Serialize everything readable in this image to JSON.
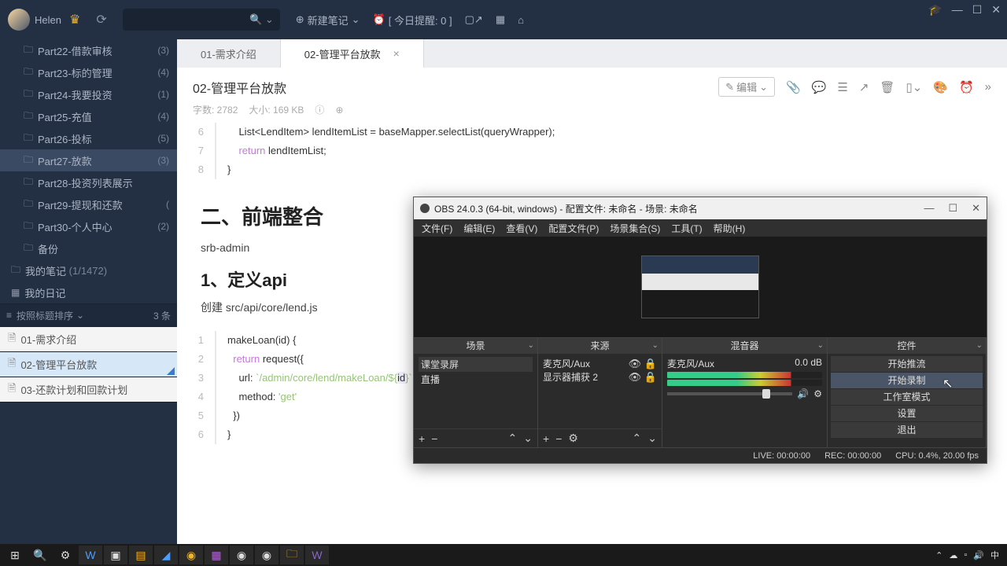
{
  "topbar": {
    "username": "Helen",
    "new_note": "新建笔记",
    "reminder": "[ 今日提醒: 0 ]"
  },
  "sidebar": {
    "folders": [
      {
        "name": "Part22-借款审核",
        "count": "(3)"
      },
      {
        "name": "Part23-标的管理",
        "count": "(4)"
      },
      {
        "name": "Part24-我要投资",
        "count": "(1)"
      },
      {
        "name": "Part25-充值",
        "count": "(4)"
      },
      {
        "name": "Part26-投标",
        "count": "(5)"
      },
      {
        "name": "Part27-放款",
        "count": "(3)"
      },
      {
        "name": "Part28-投资列表展示",
        "count": ""
      },
      {
        "name": "Part29-提现和还款",
        "count": "("
      },
      {
        "name": "Part30-个人中心",
        "count": "(2)"
      },
      {
        "name": "备份",
        "count": ""
      }
    ],
    "my_notes": "我的笔记",
    "my_notes_cnt": "(1/1472)",
    "my_diary": "我的日记",
    "sort_label": "按照标题排序",
    "sort_cnt": "3 条",
    "notes": [
      {
        "t": "01-需求介绍"
      },
      {
        "t": "02-管理平台放款"
      },
      {
        "t": "03-还款计划和回款计划"
      }
    ]
  },
  "tabs": {
    "t1": "01-需求介绍",
    "t2": "02-管理平台放款"
  },
  "doc": {
    "title": "02-管理平台放款",
    "meta_words": "字数: 2782",
    "meta_size": "大小: 169 KB",
    "edit_label": "编辑"
  },
  "code1": {
    "l6": "    List<LendItem> lendItemList = baseMapper.selectList(queryWrapper);",
    "l7a": "    ",
    "l7k": "return",
    "l7b": " lendItemList;",
    "l8": "}"
  },
  "content": {
    "h2": "二、前端整合",
    "p1": "srb-admin",
    "h3": "1、定义api",
    "p2": "创建 src/api/core/lend.js"
  },
  "code2": {
    "l1": "makeLoan(id) {",
    "l2a": "  ",
    "l2k": "return",
    "l2b": " request({",
    "l3a": "    url: ",
    "l3s": "`/admin/core/lend/makeLoan/${",
    "l3i": "id",
    "l3e": "}`",
    "l3c": ",",
    "l4a": "    method: ",
    "l4s": "'get'",
    "l5": "  })",
    "l6": "}"
  },
  "obs": {
    "title": "OBS 24.0.3 (64-bit, windows) - 配置文件: 未命名 - 场景: 未命名",
    "menu": [
      "文件(F)",
      "编辑(E)",
      "查看(V)",
      "配置文件(P)",
      "场景集合(S)",
      "工具(T)",
      "帮助(H)"
    ],
    "scenes_hd": "场景",
    "sources_hd": "来源",
    "mixer_hd": "混音器",
    "controls_hd": "控件",
    "scene1": "课堂录屏",
    "scene2": "直播",
    "src1": "麦克风/Aux",
    "src2": "显示器捕获",
    "src2n": "2",
    "mix_name": "麦克风/Aux",
    "mix_db": "0.0 dB",
    "ctrl": [
      "开始推流",
      "开始录制",
      "工作室模式",
      "设置",
      "退出"
    ],
    "status": {
      "live": "LIVE: 00:00:00",
      "rec": "REC: 00:00:00",
      "cpu": "CPU: 0.4%, 20.00 fps"
    }
  },
  "tray": {
    "ime": "中"
  }
}
